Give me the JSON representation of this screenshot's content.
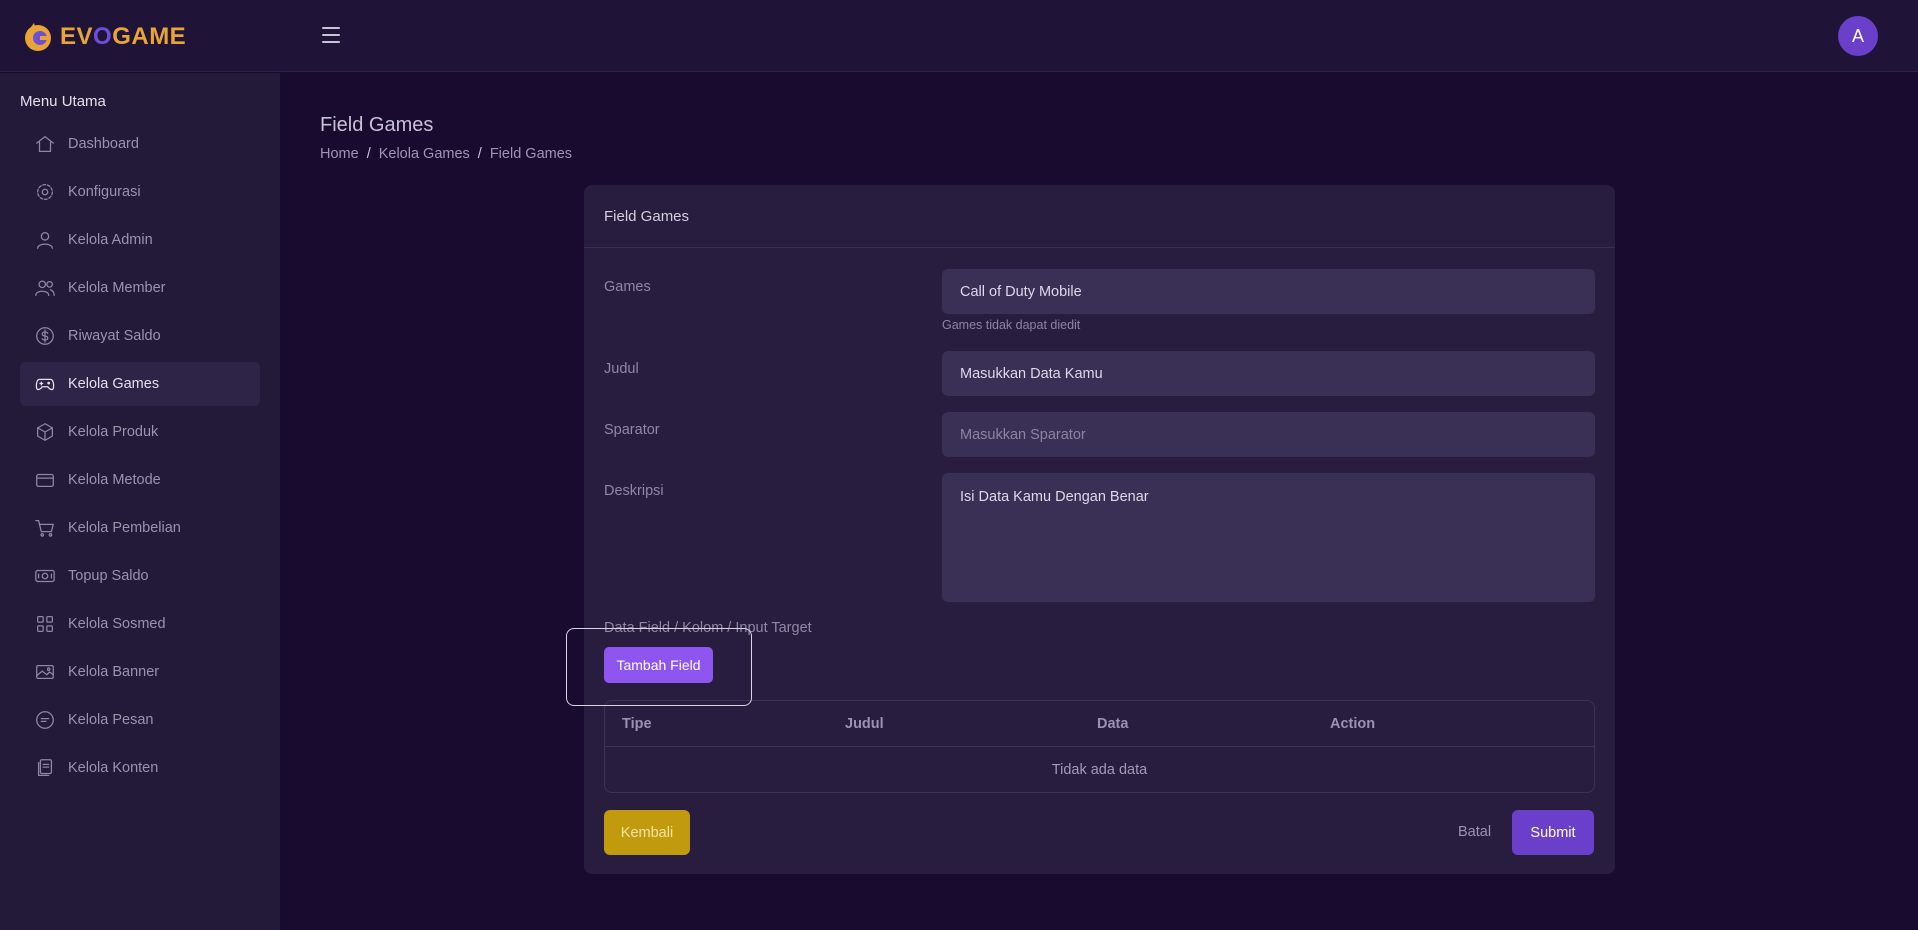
{
  "app": {
    "logo_prefix": "EV",
    "logo_o": "O",
    "logo_suffix": "GAME",
    "avatar_initial": "A"
  },
  "sidebar": {
    "heading": "Menu Utama",
    "items": [
      {
        "label": "Dashboard",
        "icon": "home-icon",
        "active": false
      },
      {
        "label": "Konfigurasi",
        "icon": "gear-icon",
        "active": false
      },
      {
        "label": "Kelola Admin",
        "icon": "user-icon",
        "active": false
      },
      {
        "label": "Kelola Member",
        "icon": "users-icon",
        "active": false
      },
      {
        "label": "Riwayat Saldo",
        "icon": "dollar-icon",
        "active": false
      },
      {
        "label": "Kelola Games",
        "icon": "gamepad-icon",
        "active": true
      },
      {
        "label": "Kelola Produk",
        "icon": "box-icon",
        "active": false
      },
      {
        "label": "Kelola Metode",
        "icon": "card-icon",
        "active": false
      },
      {
        "label": "Kelola Pembelian",
        "icon": "cart-icon",
        "active": false
      },
      {
        "label": "Topup Saldo",
        "icon": "cash-icon",
        "active": false
      },
      {
        "label": "Kelola Sosmed",
        "icon": "grid-icon",
        "active": false
      },
      {
        "label": "Kelola Banner",
        "icon": "image-icon",
        "active": false
      },
      {
        "label": "Kelola Pesan",
        "icon": "message-icon",
        "active": false
      },
      {
        "label": "Kelola Konten",
        "icon": "files-icon",
        "active": false
      }
    ]
  },
  "page": {
    "title": "Field Games",
    "breadcrumb": [
      "Home",
      "Kelola Games",
      "Field Games"
    ],
    "breadcrumb_sep": "/"
  },
  "card": {
    "title": "Field Games",
    "games_label": "Games",
    "games_value": "Call of Duty Mobile",
    "games_help": "Games tidak dapat diedit",
    "judul_label": "Judul",
    "judul_value": "Masukkan Data Kamu",
    "sparator_label": "Sparator",
    "sparator_placeholder": "Masukkan Sparator",
    "deskripsi_label": "Deskripsi",
    "deskripsi_value": "Isi Data Kamu Dengan Benar",
    "data_field_label": "Data Field / Kolom / Input Target",
    "add_button": "Tambah Field",
    "table": {
      "headers": [
        "Tipe",
        "Judul",
        "Data",
        "Action"
      ],
      "empty": "Tidak ada data"
    },
    "back_button": "Kembali",
    "cancel_button": "Batal",
    "submit_button": "Submit"
  },
  "colors": {
    "background": "#190b2f",
    "accent": "#6a3fc9",
    "add_button": "#8e55f0",
    "back_button": "#c19a0d"
  }
}
